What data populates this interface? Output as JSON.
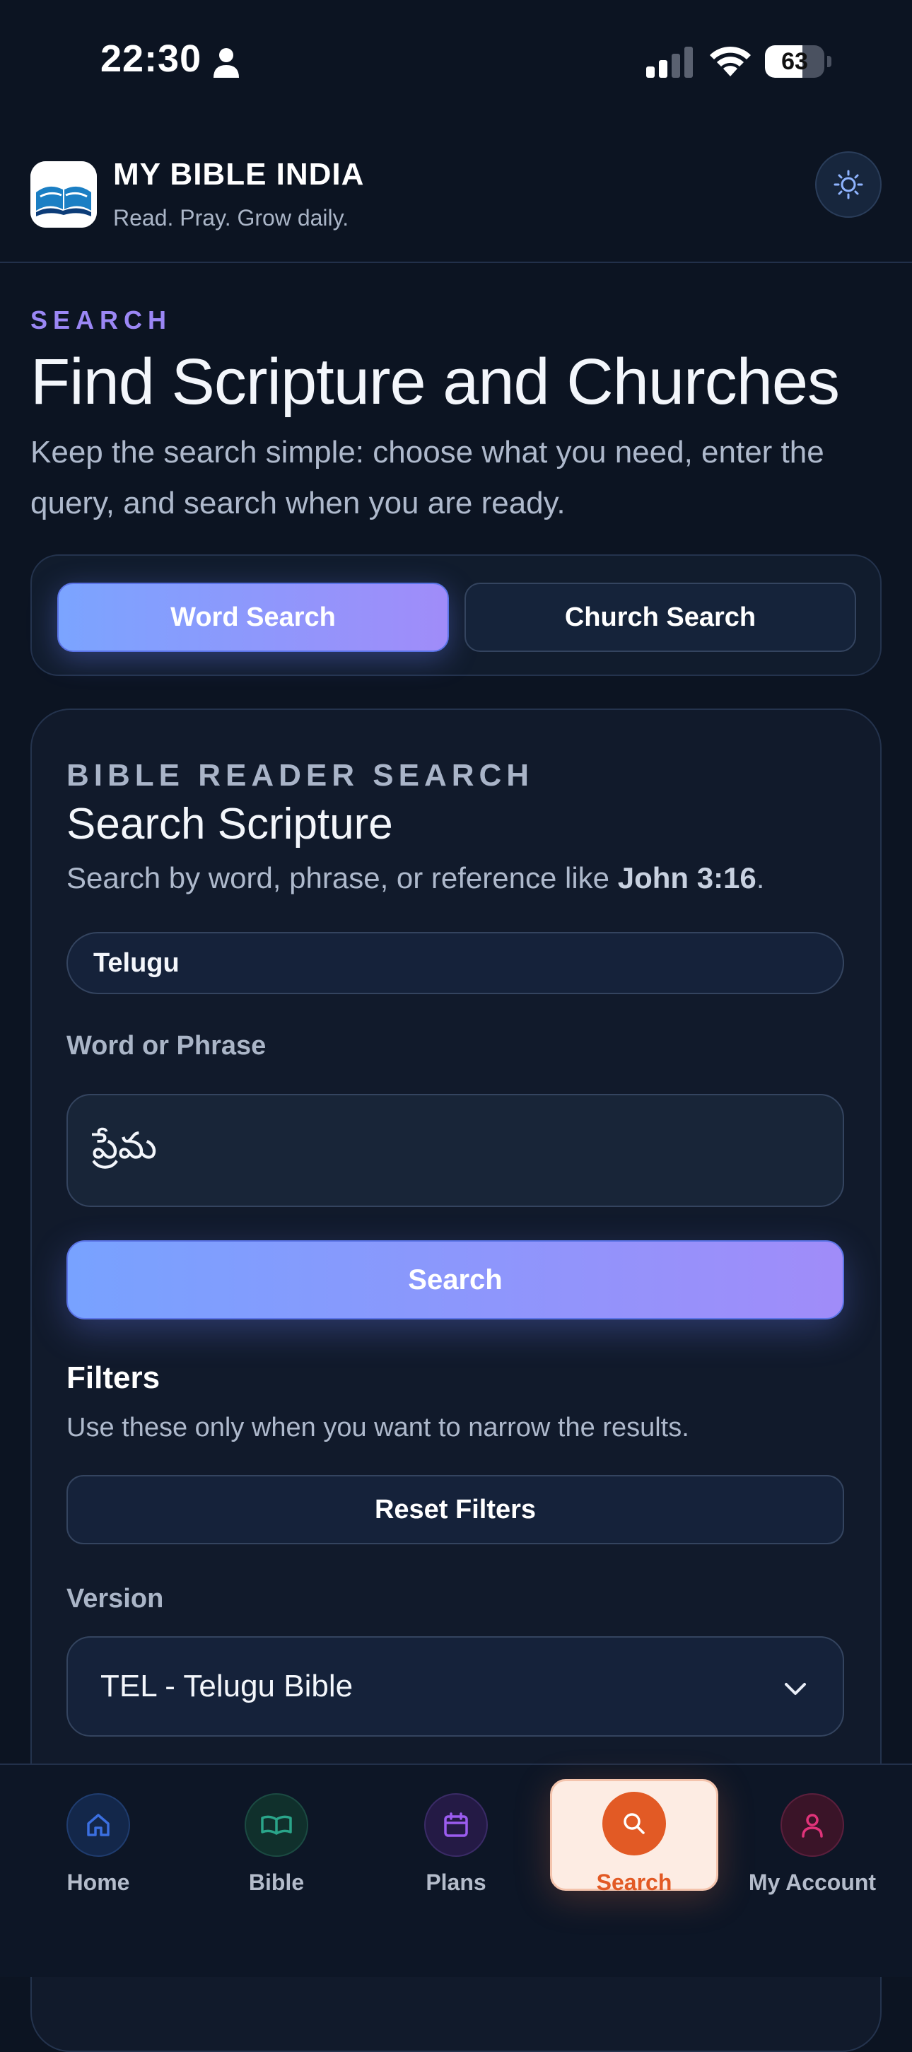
{
  "status_bar": {
    "time": "22:30",
    "battery": "63",
    "battery_level": 0.63
  },
  "header": {
    "title": "MY BIBLE INDIA",
    "tagline": "Read. Pray. Grow daily."
  },
  "hero": {
    "eyebrow": "SEARCH",
    "title": "Find Scripture and Churches",
    "description": "Keep the search simple: choose what you need, enter the query, and search when you are ready."
  },
  "tabs": [
    {
      "label": "Word Search",
      "active": true
    },
    {
      "label": "Church Search",
      "active": false
    }
  ],
  "card": {
    "eyebrow": "BIBLE READER SEARCH",
    "title": "Search Scripture",
    "description_prefix": "Search by word, phrase, or reference like ",
    "description_example": "John 3:16",
    "description_suffix": ".",
    "language": "Telugu",
    "field_label": "Word or Phrase",
    "field_value": "ప్రేమ",
    "search_label": "Search",
    "filters_title": "Filters",
    "filters_desc": "Use these only when you want to narrow the results.",
    "reset_label": "Reset Filters",
    "version_label": "Version",
    "version_value": "TEL - Telugu Bible"
  },
  "nav": [
    {
      "label": "Home",
      "icon": "home-icon",
      "color": "#3b6fe0"
    },
    {
      "label": "Bible",
      "icon": "book-icon",
      "color": "#2aa58a"
    },
    {
      "label": "Plans",
      "icon": "calendar-icon",
      "color": "#9b5cf0"
    },
    {
      "label": "Search",
      "icon": "search-icon",
      "color": "#e25a25",
      "active": true
    },
    {
      "label": "My Account",
      "icon": "user-icon",
      "color": "#e0337a"
    }
  ],
  "colors": {
    "background": "#0c1422",
    "accent": "#9b87f5",
    "active_nav": "#e25a25"
  }
}
